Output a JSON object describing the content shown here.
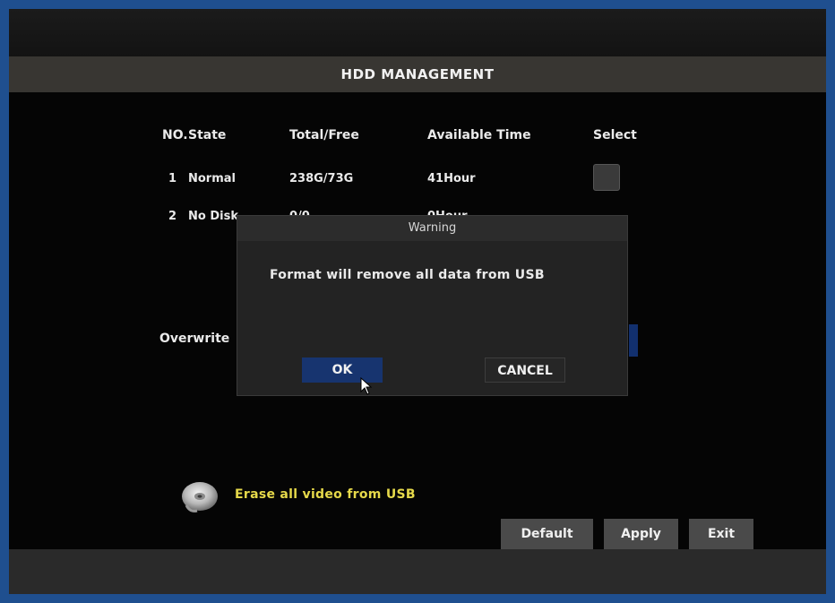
{
  "title": "HDD MANAGEMENT",
  "table": {
    "headers": [
      "NO.",
      "State",
      "Total/Free",
      "Available Time",
      "Select"
    ],
    "rows": [
      {
        "no": "1",
        "state": "Normal",
        "total_free": "238G/73G",
        "available_time": "41Hour"
      },
      {
        "no": "2",
        "state": "No Disk",
        "total_free": "0/0",
        "available_time": "0Hour"
      }
    ]
  },
  "overwrite_label": "Overwrite",
  "dialog": {
    "title": "Warning",
    "message": "Format will remove all data from USB",
    "ok_label": "OK",
    "cancel_label": "CANCEL"
  },
  "erase_label": "Erase all video from USB",
  "buttons": {
    "default_label": "Default",
    "apply_label": "Apply",
    "exit_label": "Exit"
  },
  "colors": {
    "frame_border": "#1f4f8f",
    "accent_blue": "#17346f",
    "erase_text": "#e6d94a"
  },
  "icons": {
    "usb": "disc-icon",
    "pointer": "mouse-cursor-icon"
  }
}
